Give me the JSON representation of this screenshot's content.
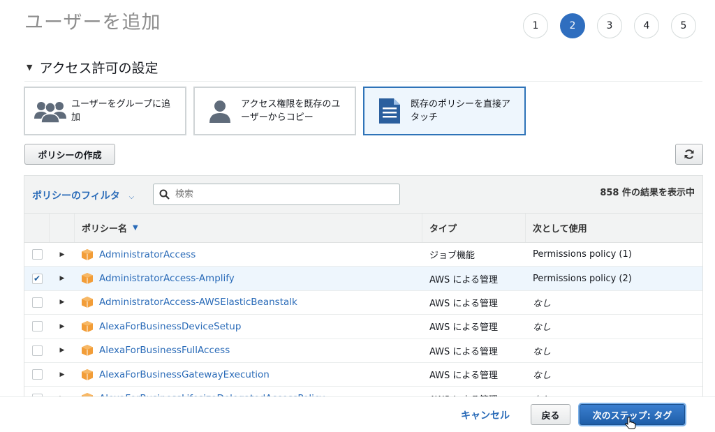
{
  "page": {
    "title": "ユーザーを追加"
  },
  "steps": [
    "1",
    "2",
    "3",
    "4",
    "5"
  ],
  "active_step": "2",
  "section": {
    "title": "アクセス許可の設定"
  },
  "options": [
    {
      "label": "ユーザーをグループに追加",
      "icon": "group-users-icon",
      "selected": false
    },
    {
      "label": "アクセス権限を既存のユーザーからコピー",
      "icon": "single-user-icon",
      "selected": false
    },
    {
      "label": "既存のポリシーを直接アタッチ",
      "icon": "document-icon",
      "selected": true
    }
  ],
  "toolbar": {
    "create_policy": "ポリシーの作成"
  },
  "table": {
    "filter_label": "ポリシーのフィルタ",
    "search_placeholder": "検索",
    "result_count": "858 件の結果を表示中",
    "headers": {
      "name": "ポリシー名",
      "type": "タイプ",
      "used_as": "次として使用"
    },
    "rows": [
      {
        "name": "AdministratorAccess",
        "type": "ジョブ機能",
        "used_as": "Permissions policy (1)",
        "checked": false
      },
      {
        "name": "AdministratorAccess-Amplify",
        "type": "AWS による管理",
        "used_as": "Permissions policy (2)",
        "checked": true
      },
      {
        "name": "AdministratorAccess-AWSElasticBeanstalk",
        "type": "AWS による管理",
        "used_as": "なし",
        "checked": false
      },
      {
        "name": "AlexaForBusinessDeviceSetup",
        "type": "AWS による管理",
        "used_as": "なし",
        "checked": false
      },
      {
        "name": "AlexaForBusinessFullAccess",
        "type": "AWS による管理",
        "used_as": "なし",
        "checked": false
      },
      {
        "name": "AlexaForBusinessGatewayExecution",
        "type": "AWS による管理",
        "used_as": "なし",
        "checked": false
      },
      {
        "name": "AlexaForBusinessLifesizeDelegatedAccessPolicy",
        "type": "AWS による管理",
        "used_as": "なし",
        "checked": false
      }
    ]
  },
  "footer": {
    "cancel": "キャンセル",
    "back": "戻る",
    "next": "次のステップ: タグ"
  },
  "colors": {
    "accent": "#2f6ebf",
    "link": "#2a6bb8",
    "package_icon": "#f29d38"
  }
}
